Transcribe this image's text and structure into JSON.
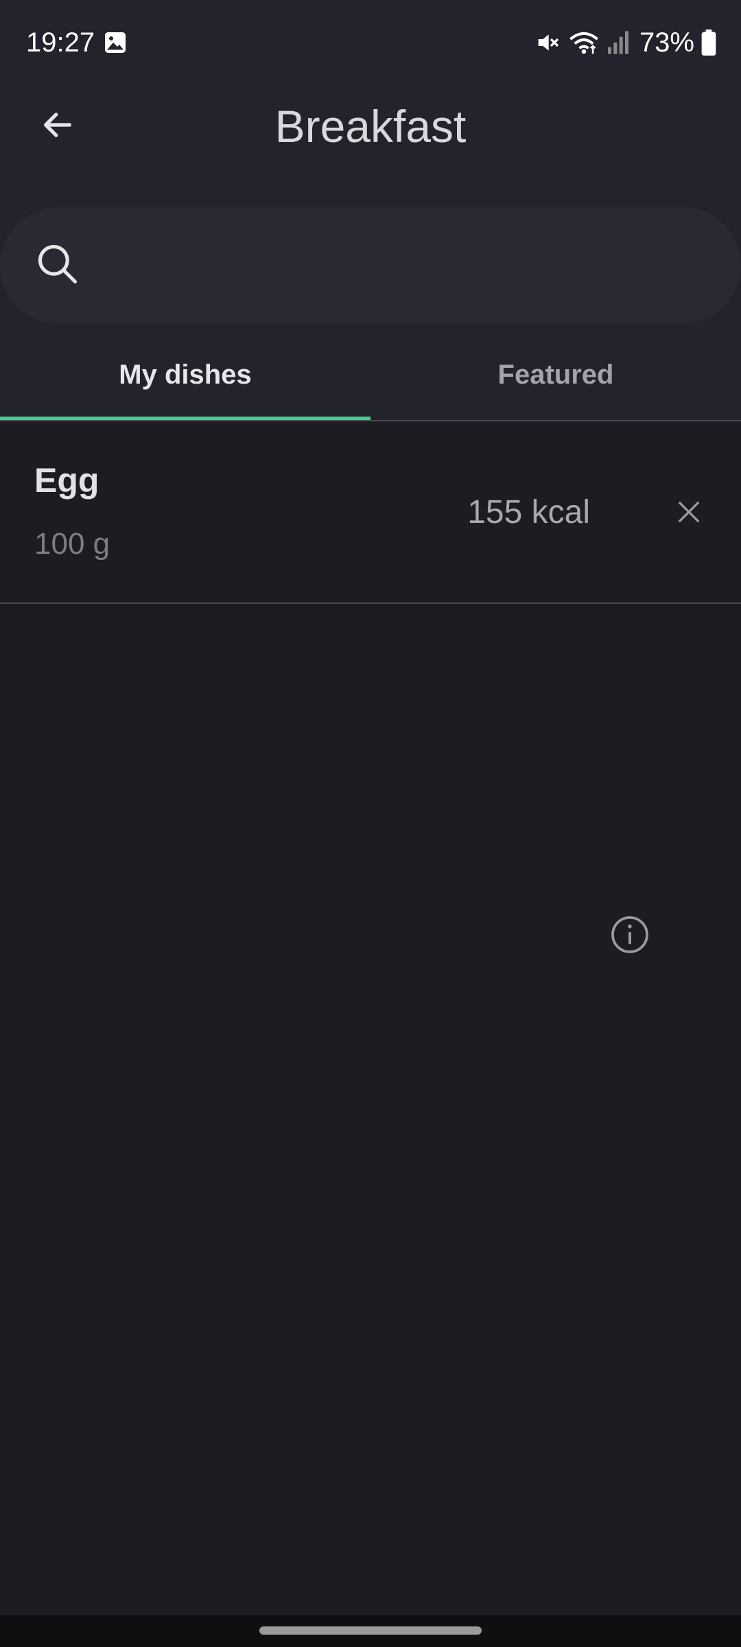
{
  "status_bar": {
    "time": "19:27",
    "battery_percent": "73%",
    "icons": [
      "gallery-icon",
      "mute-icon",
      "wifi-icon",
      "signal-icon",
      "battery-icon"
    ]
  },
  "app_bar": {
    "title": "Breakfast",
    "back_icon": "arrow-left-icon"
  },
  "search": {
    "value": "",
    "placeholder": "",
    "icon": "search-icon"
  },
  "tabs": [
    {
      "label": "My dishes",
      "active": true
    },
    {
      "label": "Featured",
      "active": false
    }
  ],
  "dishes": [
    {
      "name": "Egg",
      "quantity": "100 g",
      "kcal": "155 kcal"
    }
  ],
  "colors": {
    "accent": "#3ecf8e",
    "header_bg": "#23232d",
    "content_bg": "#1c1c22"
  }
}
